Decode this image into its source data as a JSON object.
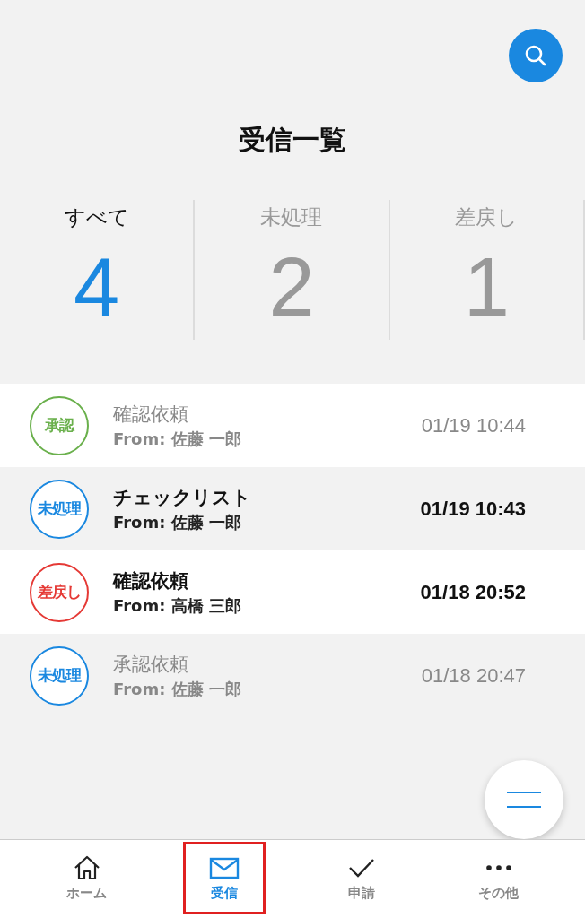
{
  "header": {
    "title": "受信一覧"
  },
  "counters": [
    {
      "label": "すべて",
      "count": "4",
      "selected": true
    },
    {
      "label": "未処理",
      "count": "2",
      "selected": false
    },
    {
      "label": "差戻し",
      "count": "1",
      "selected": false
    }
  ],
  "messages": [
    {
      "status": "承認",
      "color": "#6ab04c",
      "title": "確認依頼",
      "from": "From: 佐藤 一郎",
      "time": "01/19 10:44",
      "unread": false
    },
    {
      "status": "未処理",
      "color": "#1a88e0",
      "title": "チェックリスト",
      "from": "From: 佐藤 一郎",
      "time": "01/19 10:43",
      "unread": true
    },
    {
      "status": "差戻し",
      "color": "#e53935",
      "title": "確認依頼",
      "from": "From: 高橋 三郎",
      "time": "01/18 20:52",
      "unread": true
    },
    {
      "status": "未処理",
      "color": "#1a88e0",
      "title": "承認依頼",
      "from": "From: 佐藤 一郎",
      "time": "01/18 20:47",
      "unread": false
    }
  ],
  "nav": [
    {
      "kind": "home",
      "label": "ホーム",
      "selected": false
    },
    {
      "kind": "mail",
      "label": "受信",
      "selected": true
    },
    {
      "kind": "check",
      "label": "申請",
      "selected": false
    },
    {
      "kind": "more",
      "label": "その他",
      "selected": false
    }
  ]
}
